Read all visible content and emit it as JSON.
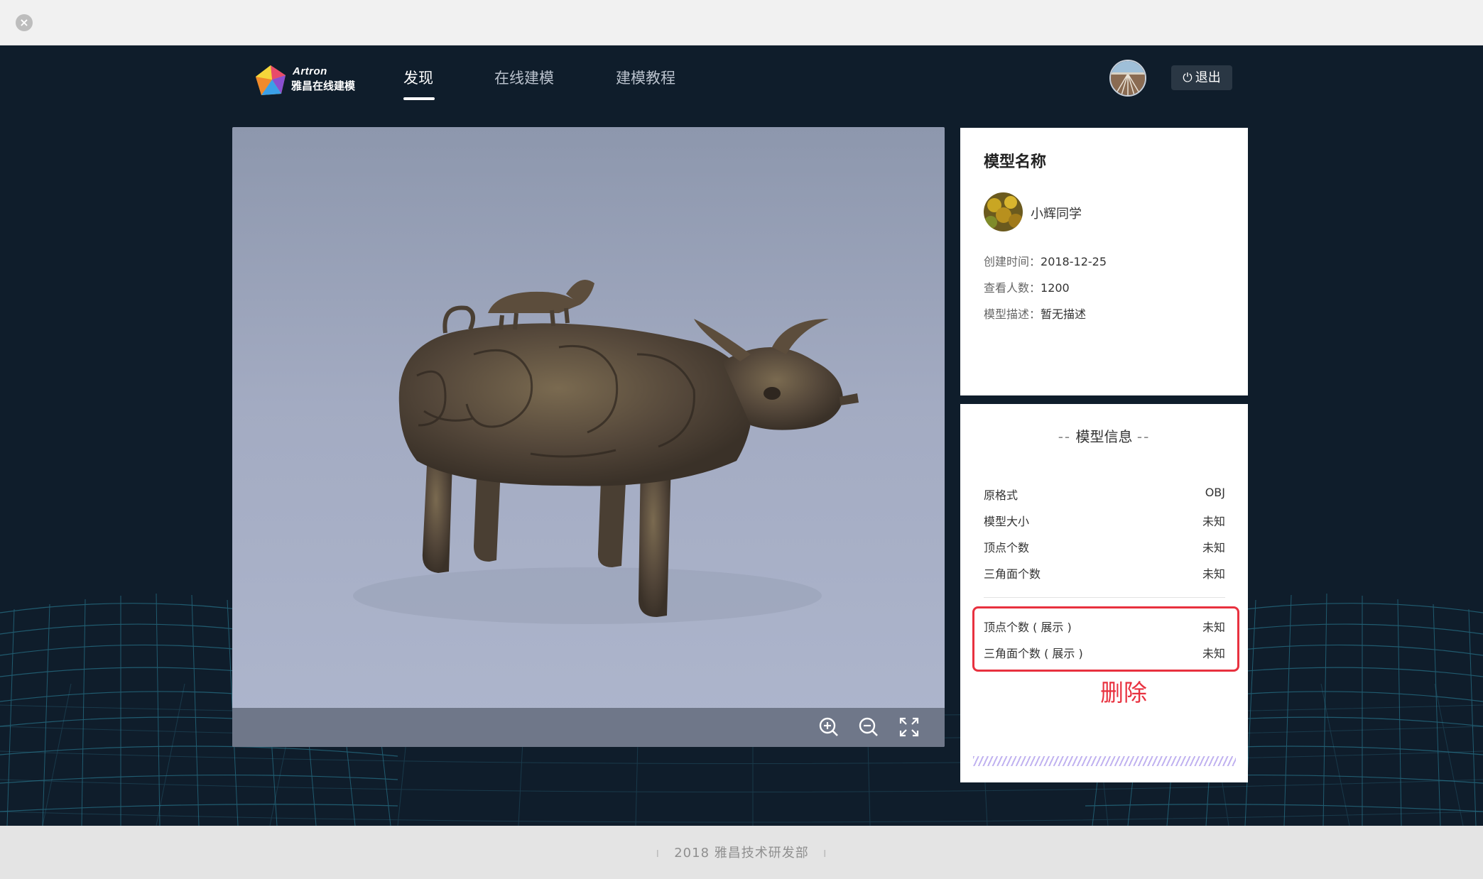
{
  "window": {
    "close_icon": "close-icon"
  },
  "header": {
    "logo_en": "Artron",
    "logo_cn": "雅昌在线建模",
    "nav": [
      {
        "label": "发现",
        "active": true
      },
      {
        "label": "在线建模",
        "active": false
      },
      {
        "label": "建模教程",
        "active": false
      }
    ],
    "logout_label": "退出"
  },
  "viewer": {
    "tools": [
      "zoom-in-icon",
      "zoom-out-icon",
      "fullscreen-icon"
    ]
  },
  "model": {
    "title": "模型名称",
    "author": "小辉同学",
    "created_label": "创建时间：",
    "created_value": "2018-12-25",
    "views_label": "查看人数：",
    "views_value": "1200",
    "desc_label": "模型描述：",
    "desc_value": "暂无描述"
  },
  "info": {
    "title_dash": "--",
    "title": "模型信息",
    "rows": [
      {
        "label": "原格式",
        "value": "OBJ"
      },
      {
        "label": "模型大小",
        "value": "未知"
      },
      {
        "label": "顶点个数",
        "value": "未知"
      },
      {
        "label": "三角面个数",
        "value": "未知"
      },
      {
        "label": "顶点个数 ( 展示 )",
        "value": "未知"
      },
      {
        "label": "三角面个数 ( 展示 )",
        "value": "未知"
      }
    ],
    "annotation": "删除"
  },
  "footer": {
    "text": "2018 雅昌技术研发部"
  },
  "colors": {
    "background": "#0f1d2b",
    "annotation_red": "#e8313f",
    "card": "#ffffff",
    "footer": "#e4e4e4"
  }
}
